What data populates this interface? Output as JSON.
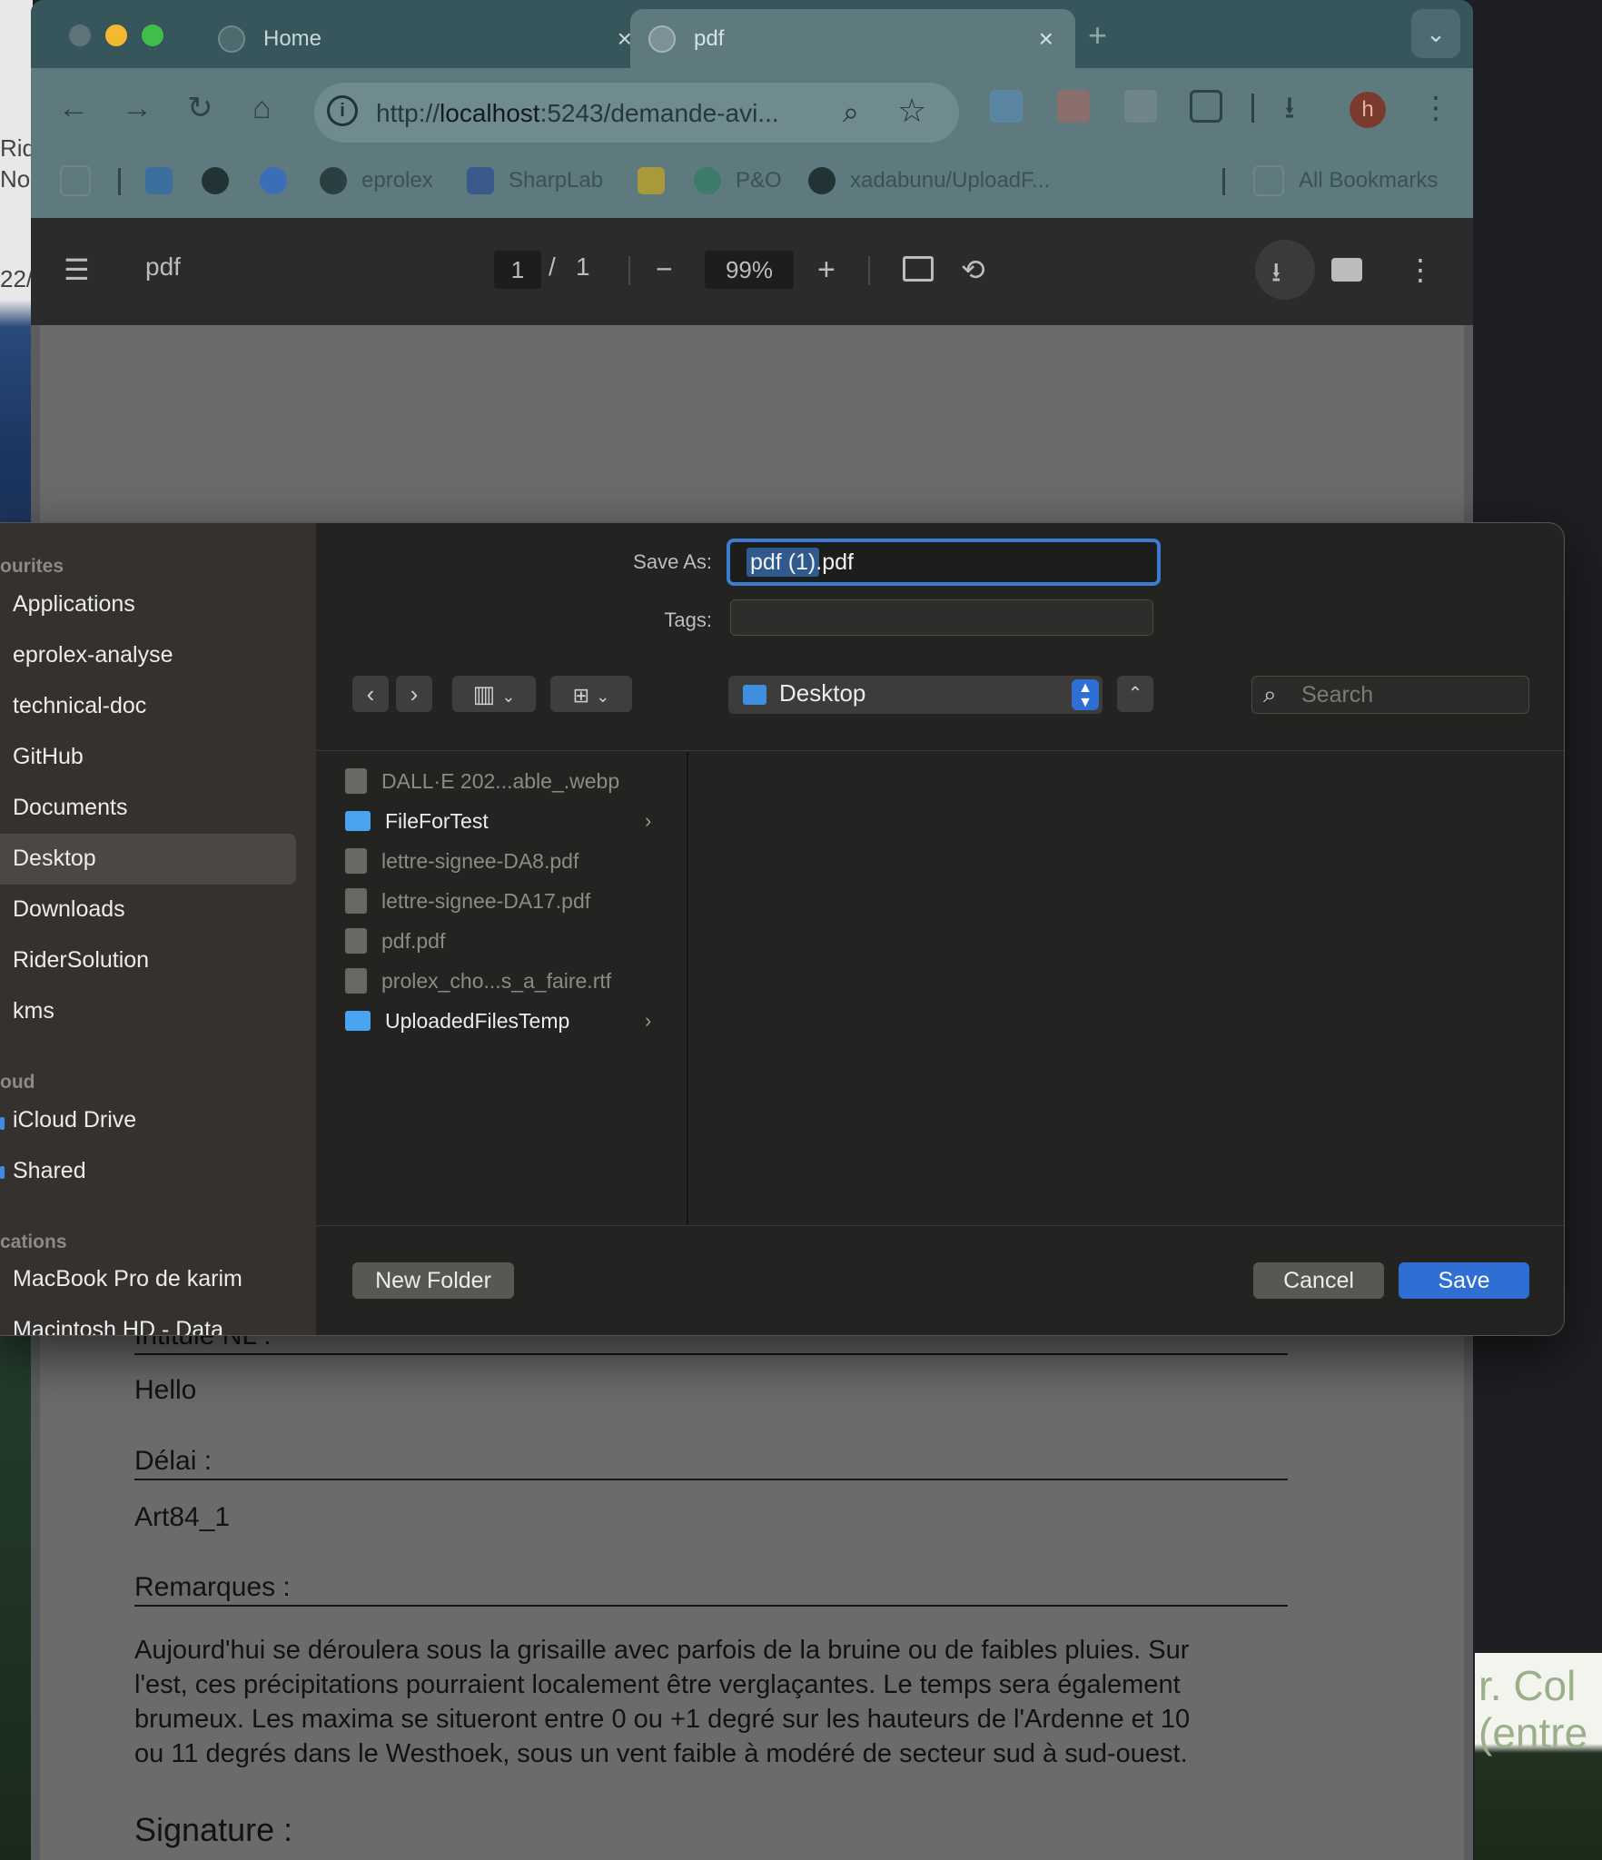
{
  "desktop": {
    "left_peek": [
      "Rid",
      "No",
      "22/"
    ],
    "right_peek": [
      "r. Col",
      "(entre"
    ]
  },
  "browser": {
    "tabs": [
      {
        "label": "Home",
        "close": "×"
      },
      {
        "label": "pdf",
        "close": "×"
      }
    ],
    "new_tab": "+",
    "tab_menu": "⌄",
    "nav": {
      "back": "←",
      "forward": "→",
      "reload": "↻",
      "home": "⌂"
    },
    "address": {
      "prefix": "http://",
      "host": "localhost",
      "rest": ":5243/demande-avi...",
      "info": "i",
      "zoom": "⌕",
      "star": "☆"
    },
    "avatar": "h",
    "more": "⋮",
    "bookmarks": [
      {
        "label": "",
        "icon": "outlook-icon"
      },
      {
        "label": "",
        "icon": "github-icon"
      },
      {
        "label": "",
        "icon": "facebook-icon"
      },
      {
        "label": "eprolex",
        "icon": "globe-icon"
      },
      {
        "label": "SharpLab",
        "icon": "sharplab-icon"
      },
      {
        "label": "",
        "icon": "miro-icon"
      },
      {
        "label": "P&O",
        "icon": "po-icon"
      },
      {
        "label": "xadabunu/UploadF...",
        "icon": "github-icon"
      },
      {
        "label": "All Bookmarks",
        "icon": "folder-icon"
      }
    ]
  },
  "pdf_viewer": {
    "menu": "☰",
    "title": "pdf",
    "page_current": "1",
    "page_sep": "/",
    "page_total": "1",
    "zoom_out": "−",
    "zoom": "99%",
    "zoom_in": "+",
    "more": "⋮"
  },
  "pdf_document": {
    "fields": [
      {
        "label": "Intitulé NL :",
        "value": "Hello"
      },
      {
        "label": "Délai :",
        "value": "Art84_1"
      }
    ],
    "remarks_label": "Remarques :",
    "remarks_lines": [
      "Aujourd'hui se déroulera sous la grisaille avec parfois de la bruine ou de faibles pluies. Sur",
      "l'est, ces précipitations pourraient localement être verglaçantes. Le temps sera également",
      "brumeux. Les maxima se situeront entre 0 ou +1 degré sur les hauteurs de l'Ardenne et 10",
      "ou 11 degrés dans le Westhoek, sous un vent faible à modéré de secteur sud à sud-ouest."
    ],
    "signature_label": "Signature :"
  },
  "save_dialog": {
    "save_as_label": "Save As:",
    "filename": "pdf (1).pdf",
    "tags_label": "Tags:",
    "tags_value": "",
    "location": "Desktop",
    "search_placeholder": "Search",
    "sidebar": {
      "favourites_heading": "ourites",
      "favourites": [
        "Applications",
        "eprolex-analyse",
        "technical-doc",
        "GitHub",
        "Documents",
        "Desktop",
        "Downloads",
        "RiderSolution",
        "kms"
      ],
      "selected": "Desktop",
      "icloud_heading": "oud",
      "icloud": [
        "iCloud Drive",
        "Shared"
      ],
      "locations_heading": "cations",
      "locations": [
        "MacBook Pro de karim",
        "Macintosh HD - Data"
      ]
    },
    "files": [
      {
        "name": "DALL·E 202...able_.webp",
        "type": "file"
      },
      {
        "name": "FileForTest",
        "type": "folder"
      },
      {
        "name": "lettre-signee-DA8.pdf",
        "type": "file"
      },
      {
        "name": "lettre-signee-DA17.pdf",
        "type": "file"
      },
      {
        "name": "pdf.pdf",
        "type": "file"
      },
      {
        "name": "prolex_cho...s_a_faire.rtf",
        "type": "file"
      },
      {
        "name": "UploadedFilesTemp",
        "type": "folder"
      }
    ],
    "buttons": {
      "new_folder": "New Folder",
      "cancel": "Cancel",
      "save": "Save"
    },
    "accent_color": "#2f6fd3"
  }
}
